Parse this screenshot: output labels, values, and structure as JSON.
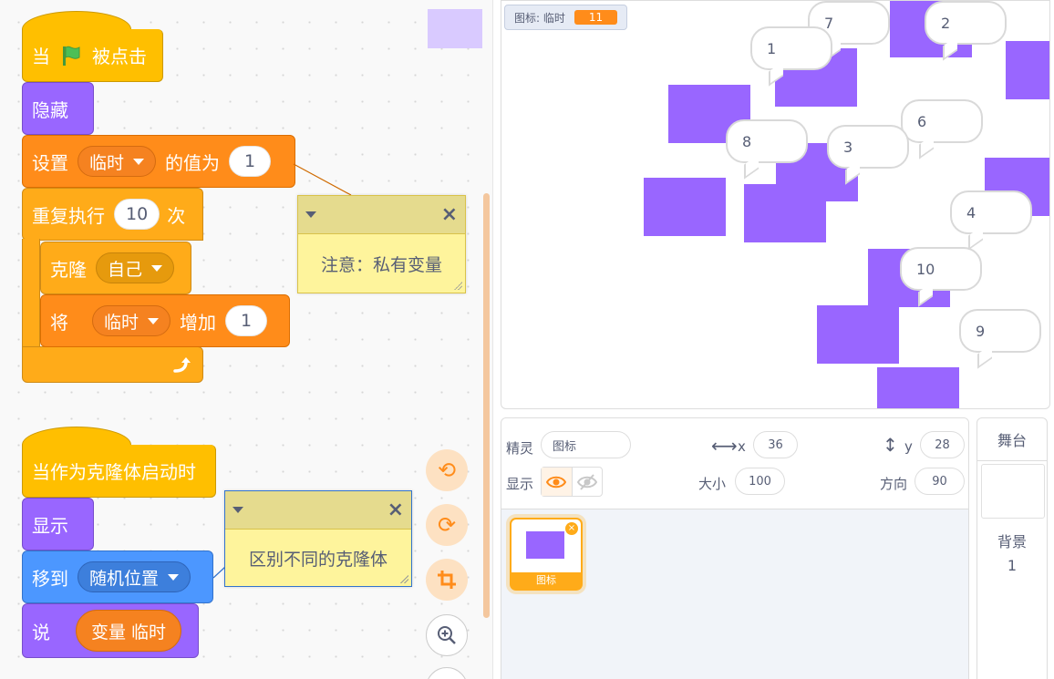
{
  "code": {
    "script1": {
      "hat": {
        "prefix": "当",
        "suffix": "被点击"
      },
      "hide": "隐藏",
      "set_var": {
        "label": "设置",
        "var": "临时",
        "mid": "的值为",
        "value": "1"
      },
      "repeat": {
        "label": "重复执行",
        "times": "10",
        "suffix": "次"
      },
      "clone": {
        "label": "克隆",
        "target": "自己"
      },
      "change_var": {
        "label": "将",
        "var": "临时",
        "mid": "增加",
        "value": "1"
      }
    },
    "script2": {
      "hat": "当作为克隆体启动时",
      "show": "显示",
      "goto": {
        "label": "移到",
        "target": "随机位置"
      },
      "say": {
        "label": "说",
        "reporter": "变量 临时"
      }
    },
    "note1": "注意：私有变量",
    "note2": "区别不同的克隆体"
  },
  "stage": {
    "monitor": {
      "label": "图标: 临时",
      "value": "11"
    },
    "bubbles": [
      "7",
      "2",
      "1",
      "6",
      "8",
      "3",
      "4",
      "10",
      "9"
    ]
  },
  "sprite_info": {
    "sprite_label": "精灵",
    "sprite_name": "图标",
    "x_label": "x",
    "x_value": "36",
    "y_label": "y",
    "y_value": "28",
    "show_label": "显示",
    "size_label": "大小",
    "size_value": "100",
    "direction_label": "方向",
    "direction_value": "90",
    "tile_name": "图标"
  },
  "stage_selector": {
    "title": "舞台",
    "backdrop_label": "背景",
    "backdrop_count": "1"
  },
  "colors": {
    "events": "#ffbf00",
    "looks": "#9966ff",
    "variables": "#ff8c1a",
    "control": "#ffab19",
    "motion": "#4c97ff"
  }
}
